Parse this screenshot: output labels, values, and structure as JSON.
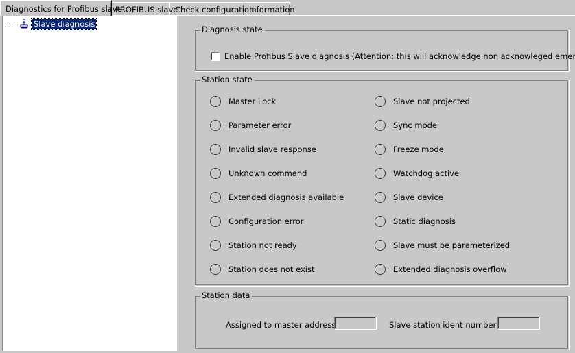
{
  "window": {
    "bg_color": "#c8c8c8",
    "panel_color": "#ffffff",
    "selection_color": "#0a246a"
  },
  "tabs": [
    {
      "label": "Diagnostics for Profibus slave",
      "active": true
    },
    {
      "label": "PROFIBUS slave",
      "active": false
    },
    {
      "label": "Check configuration",
      "active": false
    },
    {
      "label": "Information",
      "active": false
    }
  ],
  "tree": {
    "items": [
      {
        "label": "Slave diagnosis",
        "icon": "device-node-icon",
        "selected": true
      }
    ]
  },
  "diagnosis_state": {
    "title": "Diagnosis state",
    "enable_checkbox": {
      "label": "Enable Profibus Slave  diagnosis (Attention: this will acknowledge non  acknowleged emergency data)",
      "checked": false
    }
  },
  "station_state": {
    "title": "Station state",
    "left_column": [
      {
        "label": "Master Lock",
        "selected": false
      },
      {
        "label": "Parameter error",
        "selected": false
      },
      {
        "label": "Invalid slave response",
        "selected": false
      },
      {
        "label": "Unknown command",
        "selected": false
      },
      {
        "label": "Extended diagnosis available",
        "selected": false
      },
      {
        "label": "Configuration error",
        "selected": false
      },
      {
        "label": "Station not ready",
        "selected": false
      },
      {
        "label": "Station does not exist",
        "selected": false
      }
    ],
    "right_column": [
      {
        "label": "Slave not projected",
        "selected": false
      },
      {
        "label": "Sync mode",
        "selected": false
      },
      {
        "label": "Freeze mode",
        "selected": false
      },
      {
        "label": "Watchdog active",
        "selected": false
      },
      {
        "label": "Slave device",
        "selected": false
      },
      {
        "label": "Static diagnosis",
        "selected": false
      },
      {
        "label": "Slave must be parameterized",
        "selected": false
      },
      {
        "label": "Extended diagnosis overflow",
        "selected": false
      }
    ]
  },
  "station_data": {
    "title": "Station data",
    "master_address": {
      "label": "Assigned to master address:",
      "value": ""
    },
    "ident_number": {
      "label": "Slave station ident number:",
      "value": ""
    }
  }
}
